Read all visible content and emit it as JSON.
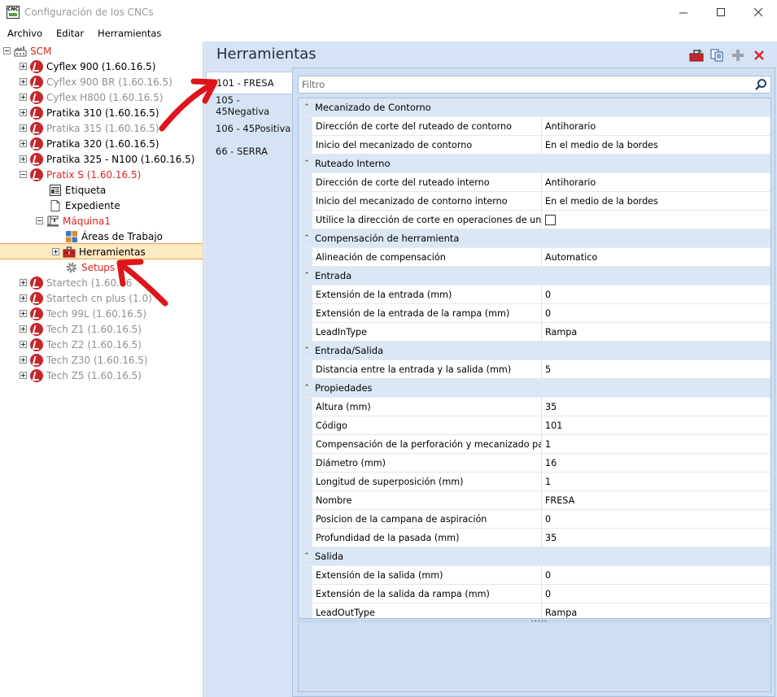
{
  "window": {
    "app_icon_text": "CNC",
    "title": "Configuración de los CNCs"
  },
  "menu": {
    "items": [
      "Archivo",
      "Editar",
      "Herramientas"
    ]
  },
  "tree": {
    "root": "SCM",
    "items": [
      {
        "label": "Cyflex 900 (1.60.16.5)",
        "style": "black"
      },
      {
        "label": "Cyflex 900 BR (1.60.16.5)",
        "style": "gray"
      },
      {
        "label": "Cyflex H800 (1.60.16.5)",
        "style": "gray"
      },
      {
        "label": "Pratika 310 (1.60.16.5)",
        "style": "black"
      },
      {
        "label": "Pratika 315 (1.60.16.5)",
        "style": "gray"
      },
      {
        "label": "Pratika 320 (1.60.16.5)",
        "style": "black"
      },
      {
        "label": "Pratika 325 - N100 (1.60.16.5)",
        "style": "black"
      },
      {
        "label": "Pratix S (1.60.16.5)",
        "style": "red"
      }
    ],
    "pratix_children": {
      "etiqueta": "Etiqueta",
      "expediente": "Expediente",
      "maquina": "Máquina1",
      "areas": "Áreas de Trabajo",
      "herramientas": "Herramientas",
      "setups": "Setups"
    },
    "items_after": [
      {
        "label": "Startech (1.60.16",
        "style": "gray"
      },
      {
        "label": "Startech cn plus (1.0)",
        "style": "gray"
      },
      {
        "label": "Tech 99L (1.60.16.5)",
        "style": "gray"
      },
      {
        "label": "Tech Z1 (1.60.16.5)",
        "style": "gray"
      },
      {
        "label": "Tech Z2 (1.60.16.5)",
        "style": "gray"
      },
      {
        "label": "Tech Z30 (1.60.16.5)",
        "style": "gray"
      },
      {
        "label": "Tech Z5 (1.60.16.5)",
        "style": "gray"
      }
    ]
  },
  "panel": {
    "title": "Herramientas",
    "tabs": [
      "101 - FRESA",
      "105 - 45Negativa",
      "106 - 45Positiva",
      "66 - SERRA"
    ],
    "filter_placeholder": "Filtro"
  },
  "grid": {
    "categories": [
      {
        "label": "Mecanizado de Contorno",
        "rows": [
          {
            "name": "Dirección de corte del ruteado de contorno",
            "value": "Antihorario"
          },
          {
            "name": "Inicio del mecanizado de contorno",
            "value": "En el medio de la bordes"
          }
        ]
      },
      {
        "label": "Ruteado Interno",
        "rows": [
          {
            "name": "Dirección de corte del ruteado interno",
            "value": "Antihorario"
          },
          {
            "name": "Inicio del mecanizado de contorno interno",
            "value": "En el medio de la bordes"
          },
          {
            "name": "Utilice la dirección de corte en operaciones de una so...",
            "value": "",
            "checkbox": true
          }
        ]
      },
      {
        "label": "Compensación de herramienta",
        "rows": [
          {
            "name": "Alineación de compensación",
            "value": "Automatico"
          }
        ]
      },
      {
        "label": "Entrada",
        "rows": [
          {
            "name": "Extensión de la entrada (mm)",
            "value": "0"
          },
          {
            "name": "Extensión de la entrada de la rampa (mm)",
            "value": "0"
          },
          {
            "name": "LeadInType",
            "value": "Rampa"
          }
        ]
      },
      {
        "label": "Entrada/Salida",
        "rows": [
          {
            "name": "Distancia entre la entrada y la salida (mm)",
            "value": "5"
          }
        ]
      },
      {
        "label": "Propiedades",
        "rows": [
          {
            "name": "Altura (mm)",
            "value": "35"
          },
          {
            "name": "Código",
            "value": "101"
          },
          {
            "name": "Compensación de la perforación y mecanizado pasan...",
            "value": "1"
          },
          {
            "name": "Diámetro (mm)",
            "value": "16"
          },
          {
            "name": "Longitud de superposición (mm)",
            "value": "1"
          },
          {
            "name": "Nombre",
            "value": "FRESA"
          },
          {
            "name": "Posicion de la campana de aspiración",
            "value": "0"
          },
          {
            "name": "Profundidad de la pasada (mm)",
            "value": "35"
          }
        ]
      },
      {
        "label": "Salida",
        "rows": [
          {
            "name": "Extensión de la salida (mm)",
            "value": "0"
          },
          {
            "name": "Extensión de la salida da rampa (mm)",
            "value": "0"
          },
          {
            "name": "LeadOutType",
            "value": "Rampa"
          }
        ]
      }
    ]
  },
  "colors": {
    "accent_red": "#d9241f",
    "panel_bg": "#d6e3f4",
    "selection": "#fde9c2"
  }
}
